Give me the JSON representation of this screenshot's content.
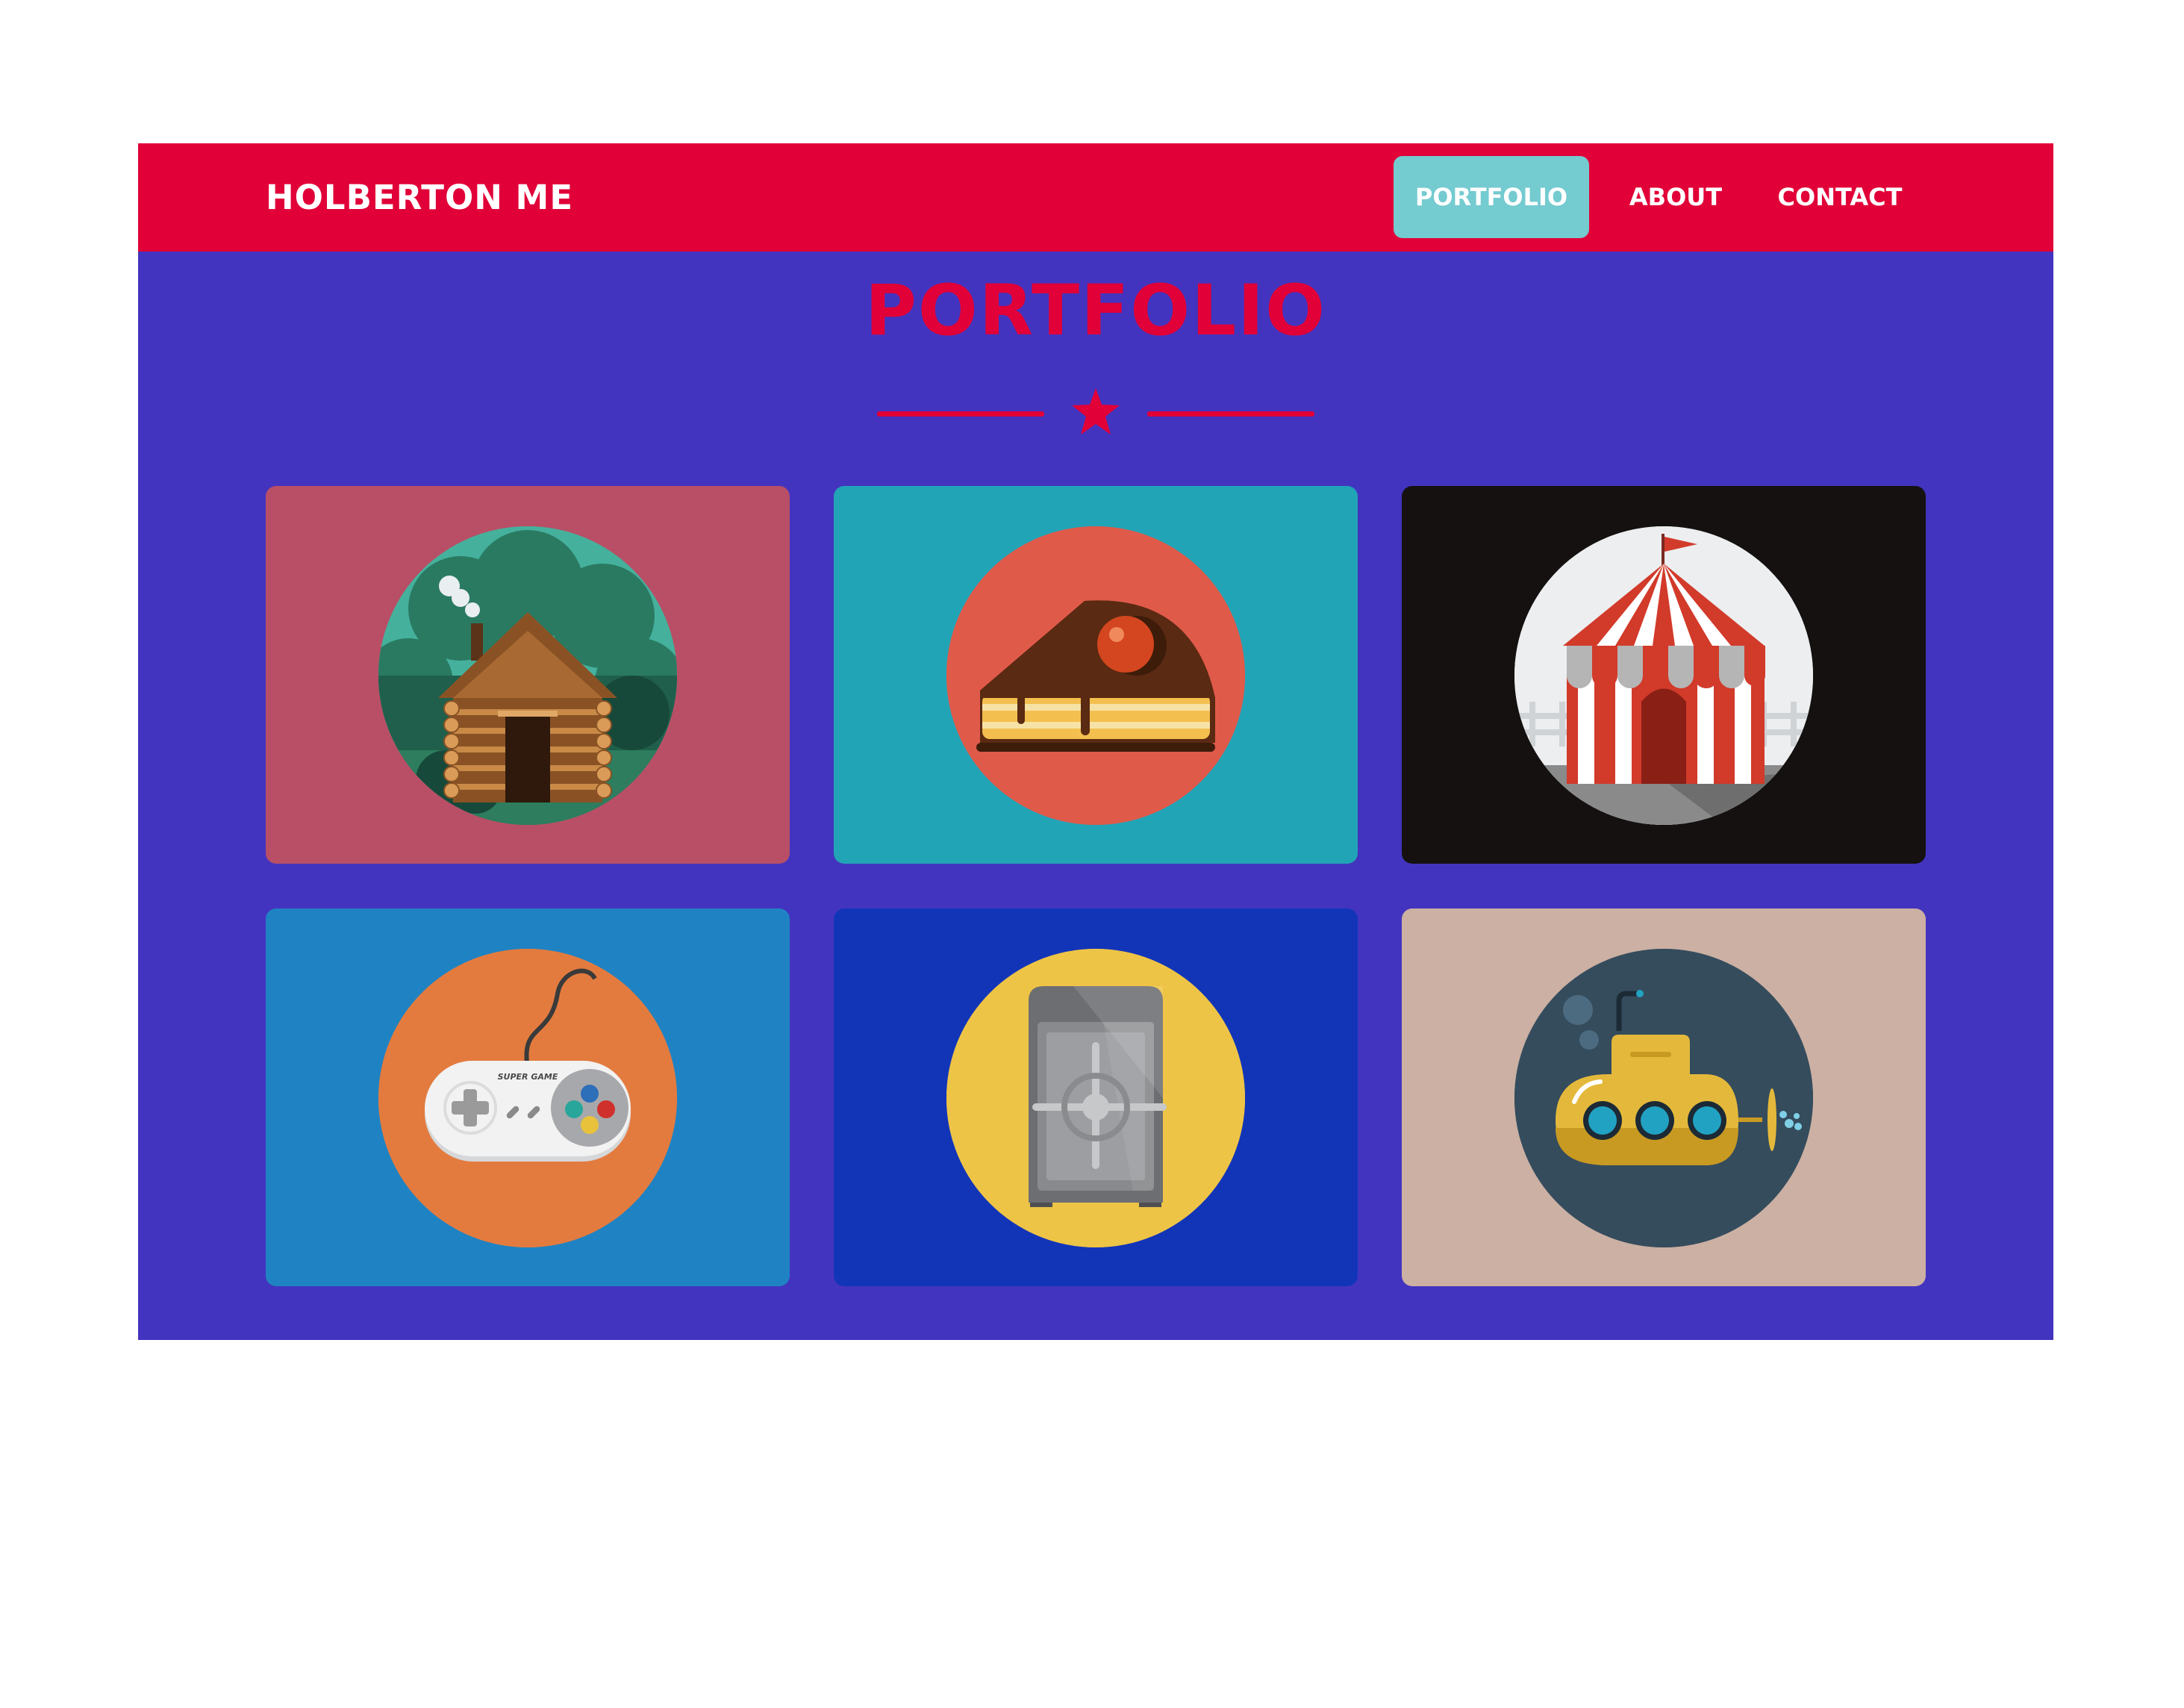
{
  "nav": {
    "brand": "HOLBERTON ME",
    "links": [
      {
        "label": "PORTFOLIO",
        "active": true
      },
      {
        "label": "ABOUT",
        "active": false
      },
      {
        "label": "CONTACT",
        "active": false
      }
    ]
  },
  "section": {
    "title": "PORTFOLIO",
    "divider_icon": "star-icon"
  },
  "portfolio": [
    {
      "icon": "log-cabin-icon",
      "bg": "#b84f66",
      "circle": "#45b19c"
    },
    {
      "icon": "cake-slice-icon",
      "bg": "#22a4b7",
      "circle": "#e05a4a"
    },
    {
      "icon": "circus-tent-icon",
      "bg": "#141110",
      "circle": "#eceeef"
    },
    {
      "icon": "game-controller-icon",
      "bg": "#1f83c3",
      "circle": "#e37b3f",
      "controller_text": "SUPER GAME"
    },
    {
      "icon": "safe-icon",
      "bg": "#1235b8",
      "circle": "#eec447"
    },
    {
      "icon": "submarine-icon",
      "bg": "#cbb0a3",
      "circle": "#354c5d"
    }
  ],
  "colors": {
    "accent": "#e10038",
    "page_bg": "#4334bf",
    "active_nav": "#74cbd0"
  }
}
